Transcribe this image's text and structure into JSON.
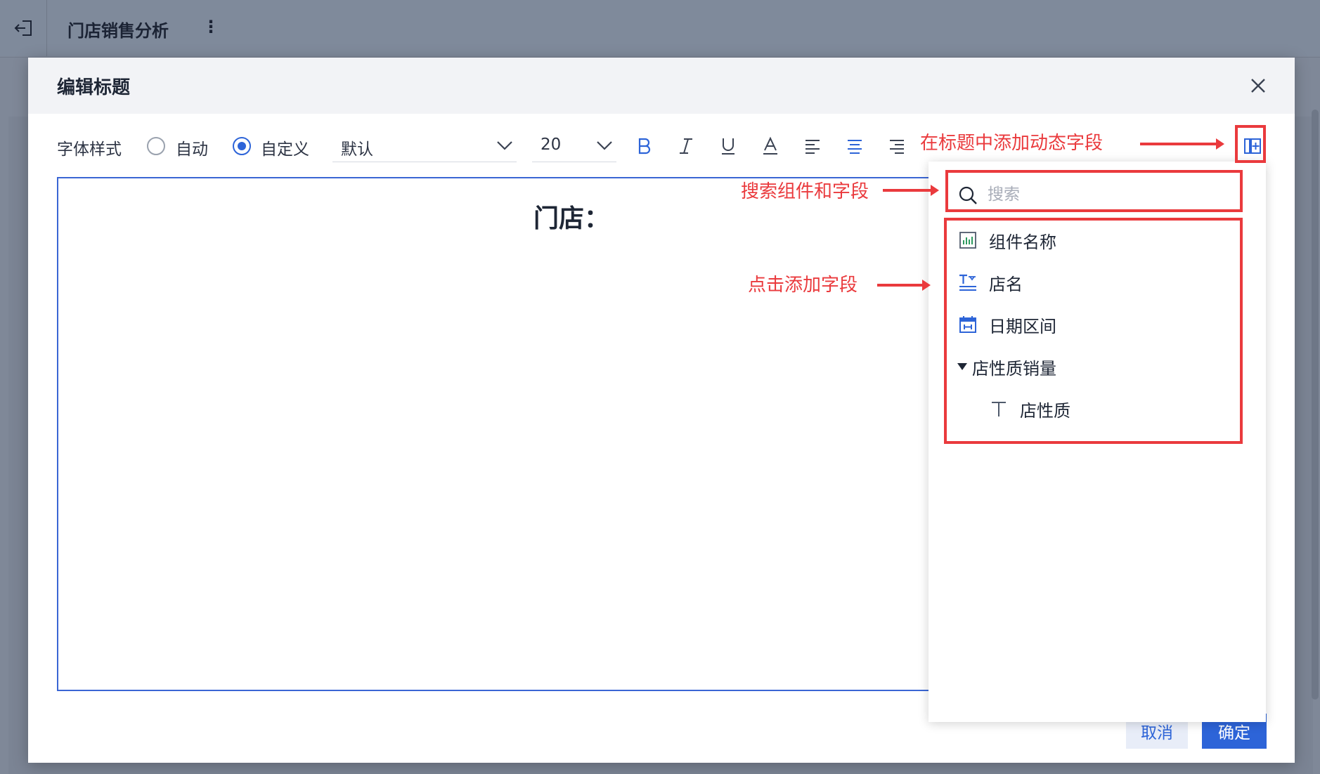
{
  "app": {
    "title": "门店销售分析",
    "more_icon": "⋮"
  },
  "dialog": {
    "title": "编辑标题",
    "font_style_label": "字体样式",
    "radio_auto": "自动",
    "radio_custom": "自定义",
    "font_family_value": "默认",
    "font_size_value": "20",
    "editor_text": "门店：",
    "cancel_label": "取消",
    "ok_label": "确定"
  },
  "panel": {
    "search_placeholder": "搜索",
    "fields": [
      {
        "label": "组件名称",
        "icon": "chart-icon"
      },
      {
        "label": "店名",
        "icon": "text-dimension-icon"
      },
      {
        "label": "日期区间",
        "icon": "calendar-icon"
      },
      {
        "label": "店性质销量",
        "icon": "caret-down-icon"
      },
      {
        "label": "店性质",
        "icon": "text-field-icon"
      }
    ]
  },
  "annotations": {
    "add_dynamic_field": "在标题中添加动态字段",
    "search_fields": "搜索组件和字段",
    "click_add_field": "点击添加字段"
  },
  "colors": {
    "accent": "#2d64d8",
    "annotation": "#ea3a3d",
    "overlay": "#7f8898"
  }
}
